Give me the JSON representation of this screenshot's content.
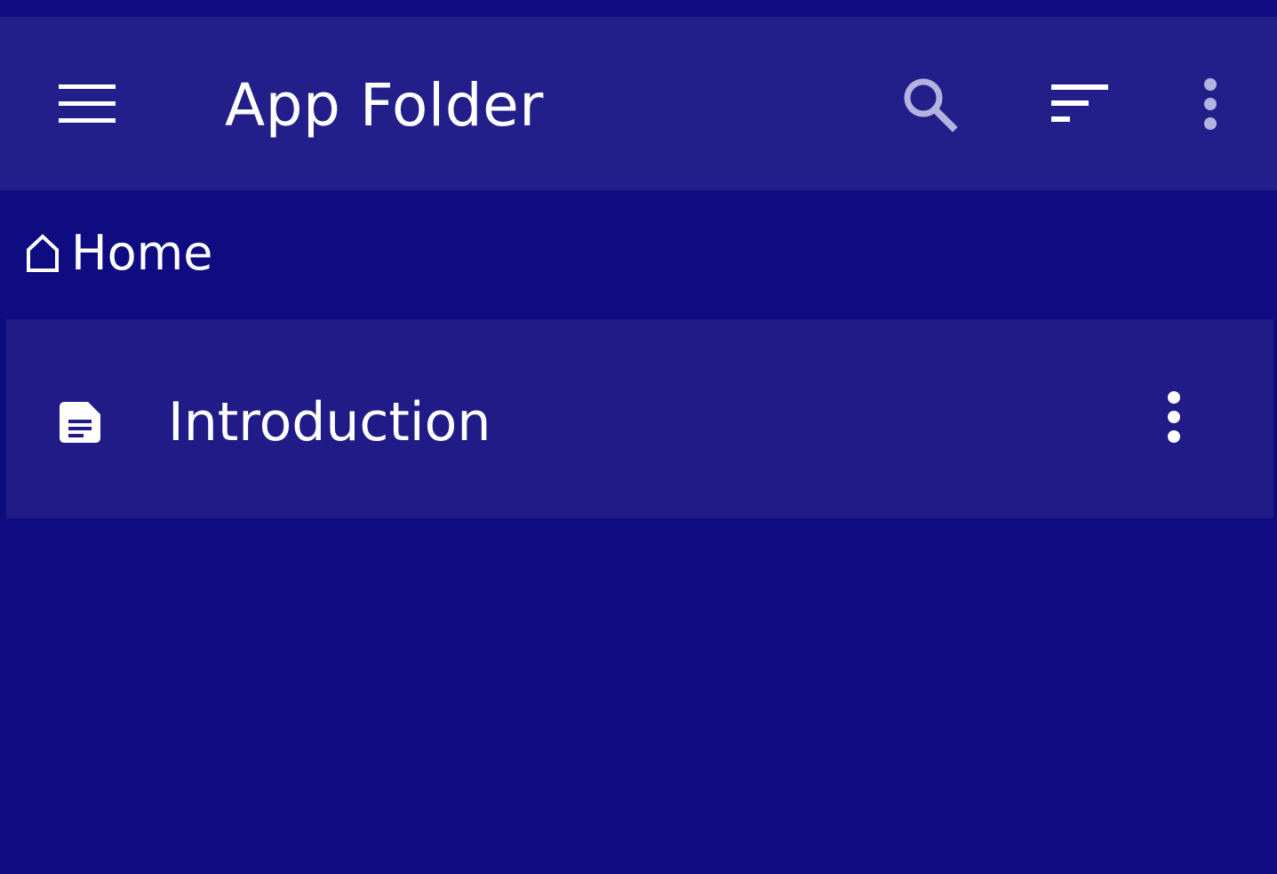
{
  "status_bar": {},
  "app_bar": {
    "title": "App Folder",
    "icons": {
      "menu": "menu-icon",
      "search": "search-icon",
      "sort": "sort-icon",
      "more": "more-vert-icon"
    }
  },
  "breadcrumb": {
    "icon": "home-icon",
    "label": "Home"
  },
  "files": [
    {
      "name": "Introduction",
      "icon": "document-icon",
      "menu_icon": "more-vert-icon"
    }
  ],
  "colors": {
    "background": "#0f0b80",
    "app_bar": "#231f8a",
    "row": "#211b88",
    "text": "#ffffff",
    "icon_muted": "#b4b2e0"
  }
}
